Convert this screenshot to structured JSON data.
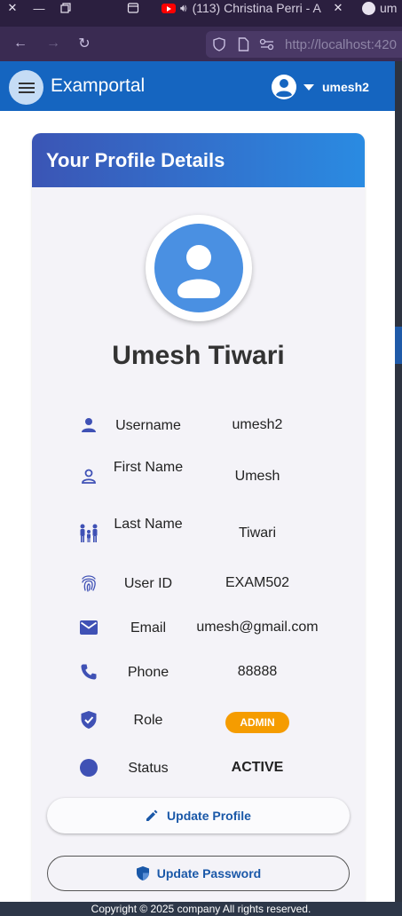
{
  "browser": {
    "tab_title": "(113) Christina Perri - A",
    "tab_right_label": "um",
    "url": "http://localhost:420"
  },
  "header": {
    "brand": "Examportal",
    "username": "umesh2"
  },
  "profile": {
    "card_title": "Your Profile Details",
    "full_name": "Umesh Tiwari",
    "fields": [
      {
        "label": "Username",
        "value": "umesh2",
        "icon": "person-icon"
      },
      {
        "label": "First Name",
        "value": "Umesh",
        "icon": "person-outline-icon"
      },
      {
        "label": "Last Name",
        "value": "Tiwari",
        "icon": "family-icon"
      },
      {
        "label": "User ID",
        "value": "EXAM502",
        "icon": "fingerprint-icon"
      },
      {
        "label": "Email",
        "value": "umesh@gmail.com",
        "icon": "email-icon"
      },
      {
        "label": "Phone",
        "value": "88888",
        "icon": "phone-icon"
      },
      {
        "label": "Role",
        "value": "ADMIN",
        "icon": "shield-check-icon"
      },
      {
        "label": "Status",
        "value": "ACTIVE",
        "icon": "circle-icon"
      }
    ],
    "update_profile_label": "Update Profile",
    "update_password_label": "Update Password"
  },
  "footer": {
    "text": "Copyright © 2025 company All rights reserved."
  },
  "colors": {
    "header_blue": "#1565c0",
    "icon_blue": "#3f51b5",
    "badge_orange": "#f59c00",
    "active_green": "#1a8c1a"
  }
}
